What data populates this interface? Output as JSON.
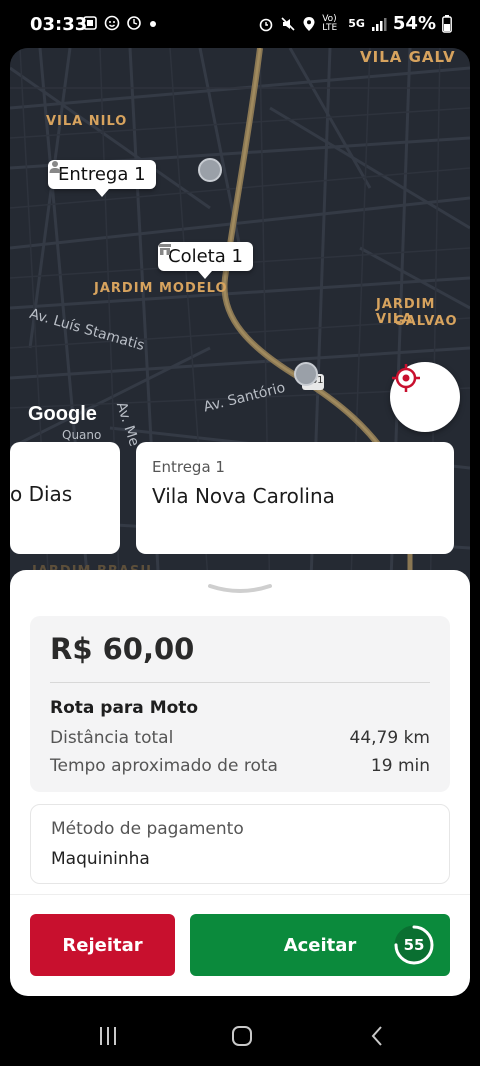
{
  "status_bar": {
    "time": "03:33",
    "left_icons": [
      "screenshot-icon",
      "face-icon",
      "sync-icon",
      "dot-icon"
    ],
    "right_icons": [
      "alarm-icon",
      "mute-icon",
      "location-icon",
      "volte-icon",
      "5g-icon",
      "signal-icon",
      "battery-icon"
    ],
    "lte_label": "Vo) LTE",
    "net_label": "5G",
    "battery": "54%"
  },
  "map": {
    "areas": [
      "VILA GALV",
      "VILA NILO",
      "JARDIM MODELO",
      "JARDIM VILA",
      "GALVAO",
      "JARDIM BRASIL"
    ],
    "streets": [
      "Av. Luís Stamatis",
      "Av. Santório",
      "Av. Me",
      "Quano"
    ],
    "route_shield": "381",
    "google": "Google",
    "markers": {
      "delivery": "Entrega 1",
      "pickup": "Coleta 1"
    },
    "accent": "#c8102e"
  },
  "cards": {
    "prev_city": "o Dias",
    "current_kind": "Entrega 1",
    "current_city": "Vila Nova Carolina"
  },
  "offer": {
    "price": "R$ 60,00",
    "route_title": "Rota para Moto",
    "distance_label": "Distância total",
    "distance_value": "44,79 km",
    "time_label": "Tempo aproximado de rota",
    "time_value": "19 min"
  },
  "payment": {
    "label": "Método de pagamento",
    "value": "Maquininha"
  },
  "actions": {
    "reject": "Rejeitar",
    "accept": "Aceitar",
    "countdown": "55",
    "countdown_fraction": 0.75,
    "reject_color": "#c8102e",
    "accept_color": "#0b8a3c"
  },
  "nav": {
    "icons": [
      "recents-icon",
      "home-icon",
      "back-icon"
    ]
  }
}
